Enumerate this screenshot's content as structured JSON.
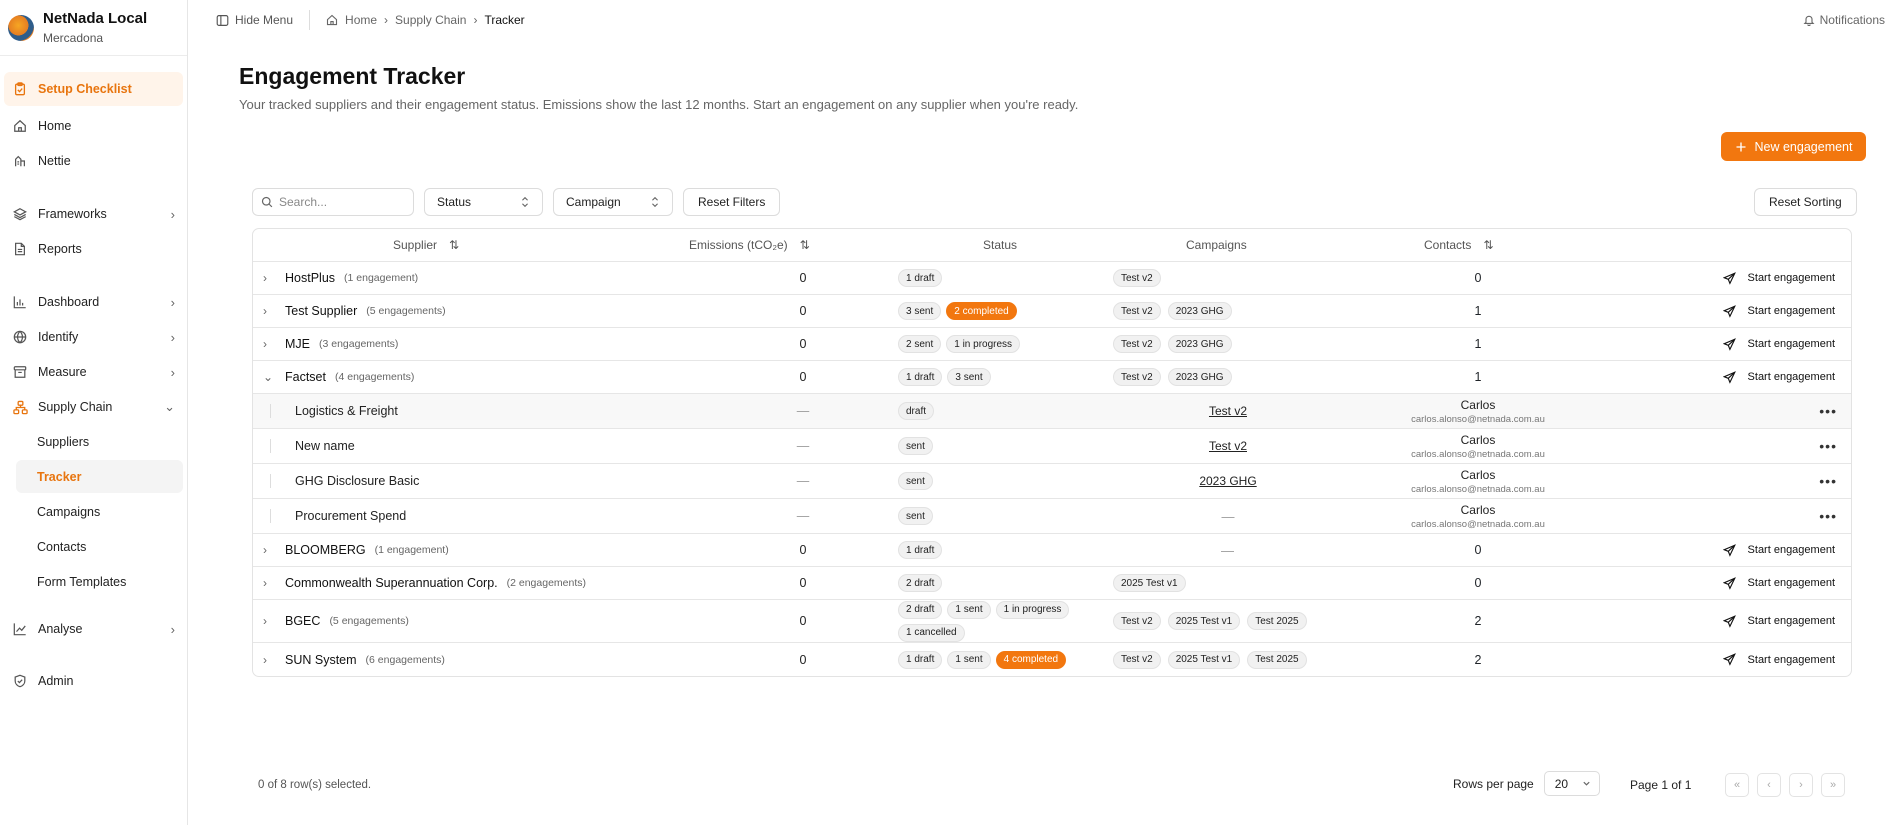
{
  "brand": {
    "title": "NetNada Local",
    "subtitle": "Mercadona"
  },
  "sidebar": {
    "setup": "Setup Checklist",
    "items_a": [
      {
        "label": "Home",
        "icon": "home-icon"
      },
      {
        "label": "Nettie",
        "icon": "nettie-icon"
      }
    ],
    "items_b": [
      {
        "label": "Frameworks",
        "icon": "layers-icon",
        "chevron": true
      },
      {
        "label": "Reports",
        "icon": "file-icon",
        "chevron": false
      }
    ],
    "items_c": [
      {
        "label": "Dashboard",
        "icon": "chart-icon",
        "chevron": true
      },
      {
        "label": "Identify",
        "icon": "globe-icon",
        "chevron": true
      },
      {
        "label": "Measure",
        "icon": "archive-icon",
        "chevron": true
      }
    ],
    "supply_chain": "Supply Chain",
    "supply_children": [
      "Suppliers",
      "Tracker",
      "Campaigns",
      "Contacts",
      "Form Templates"
    ],
    "analyse": "Analyse",
    "admin": "Admin"
  },
  "topbar": {
    "hide_menu": "Hide Menu",
    "breadcrumb": [
      "Home",
      "Supply Chain",
      "Tracker"
    ],
    "notifications": "Notifications"
  },
  "page": {
    "title": "Engagement Tracker",
    "description": "Your tracked suppliers and their engagement status. Emissions show the last 12 months. Start an engagement on any supplier when you're ready.",
    "new_button": "New engagement"
  },
  "filters": {
    "search_placeholder": "Search...",
    "status": "Status",
    "campaign": "Campaign",
    "reset_filters": "Reset Filters",
    "reset_sorting": "Reset Sorting"
  },
  "table": {
    "headers": {
      "supplier": "Supplier",
      "emissions": "Emissions (tCO₂e)",
      "status": "Status",
      "campaigns": "Campaigns",
      "contacts": "Contacts"
    },
    "action_label": "Start engagement",
    "rows": [
      {
        "name": "HostPlus",
        "count": "(1 engagement)",
        "emissions": "0",
        "status": [
          "1 draft"
        ],
        "campaigns": [
          "Test v2"
        ],
        "contacts": "0"
      },
      {
        "name": "Test Supplier",
        "count": "(5 engagements)",
        "emissions": "0",
        "status": [
          "3 sent",
          "2 completed"
        ],
        "campaigns": [
          "Test v2",
          "2023 GHG"
        ],
        "contacts": "1"
      },
      {
        "name": "MJE",
        "count": "(3 engagements)",
        "emissions": "0",
        "status": [
          "2 sent",
          "1 in progress"
        ],
        "campaigns": [
          "Test v2",
          "2023 GHG"
        ],
        "contacts": "1"
      },
      {
        "name": "Factset",
        "count": "(4 engagements)",
        "emissions": "0",
        "status": [
          "1 draft",
          "3 sent"
        ],
        "campaigns": [
          "Test v2",
          "2023 GHG"
        ],
        "contacts": "1",
        "expanded": true
      },
      {
        "name": "BLOOMBERG",
        "count": "(1 engagement)",
        "emissions": "0",
        "status": [
          "1 draft"
        ],
        "campaigns": [],
        "contacts": "0"
      },
      {
        "name": "Commonwealth Superannuation Corp.",
        "count": "(2 engagements)",
        "emissions": "0",
        "status": [
          "2 draft"
        ],
        "campaigns": [
          "2025 Test v1"
        ],
        "contacts": "0"
      },
      {
        "name": "BGEC",
        "count": "(5 engagements)",
        "emissions": "0",
        "status": [
          "2 draft",
          "1 sent",
          "1 in progress",
          "1 cancelled"
        ],
        "campaigns": [
          "Test v2",
          "2025 Test v1",
          "Test 2025"
        ],
        "contacts": "2"
      },
      {
        "name": "SUN System",
        "count": "(6 engagements)",
        "emissions": "0",
        "status": [
          "1 draft",
          "1 sent",
          "4 completed"
        ],
        "campaigns": [
          "Test v2",
          "2025 Test v1",
          "Test 2025"
        ],
        "contacts": "2"
      }
    ],
    "children": [
      {
        "name": "Logistics & Freight",
        "emissions": "—",
        "status": "draft",
        "campaign": "Test v2",
        "contact_name": "Carlos",
        "contact_email": "carlos.alonso@netnada.com.au"
      },
      {
        "name": "New name",
        "emissions": "—",
        "status": "sent",
        "campaign": "Test v2",
        "contact_name": "Carlos",
        "contact_email": "carlos.alonso@netnada.com.au"
      },
      {
        "name": "GHG Disclosure Basic",
        "emissions": "—",
        "status": "sent",
        "campaign": "2023 GHG",
        "contact_name": "Carlos",
        "contact_email": "carlos.alonso@netnada.com.au"
      },
      {
        "name": "Procurement Spend",
        "emissions": "—",
        "status": "sent",
        "campaign": "—",
        "contact_name": "Carlos",
        "contact_email": "carlos.alonso@netnada.com.au"
      }
    ]
  },
  "footer": {
    "selected": "0 of 8 row(s) selected.",
    "rows_per_page_label": "Rows per page",
    "rows_per_page": "20",
    "page_info": "Page 1 of 1"
  },
  "colors": {
    "accent": "#f2770f"
  }
}
